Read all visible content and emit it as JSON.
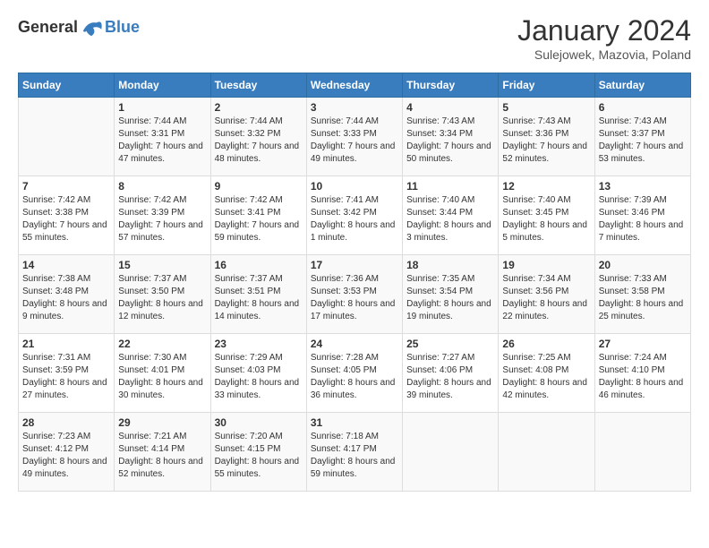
{
  "header": {
    "logo_general": "General",
    "logo_blue": "Blue",
    "month_title": "January 2024",
    "subtitle": "Sulejowek, Mazovia, Poland"
  },
  "days_of_week": [
    "Sunday",
    "Monday",
    "Tuesday",
    "Wednesday",
    "Thursday",
    "Friday",
    "Saturday"
  ],
  "weeks": [
    [
      {
        "day": "",
        "info": ""
      },
      {
        "day": "1",
        "info": "Sunrise: 7:44 AM\nSunset: 3:31 PM\nDaylight: 7 hours and 47 minutes."
      },
      {
        "day": "2",
        "info": "Sunrise: 7:44 AM\nSunset: 3:32 PM\nDaylight: 7 hours and 48 minutes."
      },
      {
        "day": "3",
        "info": "Sunrise: 7:44 AM\nSunset: 3:33 PM\nDaylight: 7 hours and 49 minutes."
      },
      {
        "day": "4",
        "info": "Sunrise: 7:43 AM\nSunset: 3:34 PM\nDaylight: 7 hours and 50 minutes."
      },
      {
        "day": "5",
        "info": "Sunrise: 7:43 AM\nSunset: 3:36 PM\nDaylight: 7 hours and 52 minutes."
      },
      {
        "day": "6",
        "info": "Sunrise: 7:43 AM\nSunset: 3:37 PM\nDaylight: 7 hours and 53 minutes."
      }
    ],
    [
      {
        "day": "7",
        "info": "Sunrise: 7:42 AM\nSunset: 3:38 PM\nDaylight: 7 hours and 55 minutes."
      },
      {
        "day": "8",
        "info": "Sunrise: 7:42 AM\nSunset: 3:39 PM\nDaylight: 7 hours and 57 minutes."
      },
      {
        "day": "9",
        "info": "Sunrise: 7:42 AM\nSunset: 3:41 PM\nDaylight: 7 hours and 59 minutes."
      },
      {
        "day": "10",
        "info": "Sunrise: 7:41 AM\nSunset: 3:42 PM\nDaylight: 8 hours and 1 minute."
      },
      {
        "day": "11",
        "info": "Sunrise: 7:40 AM\nSunset: 3:44 PM\nDaylight: 8 hours and 3 minutes."
      },
      {
        "day": "12",
        "info": "Sunrise: 7:40 AM\nSunset: 3:45 PM\nDaylight: 8 hours and 5 minutes."
      },
      {
        "day": "13",
        "info": "Sunrise: 7:39 AM\nSunset: 3:46 PM\nDaylight: 8 hours and 7 minutes."
      }
    ],
    [
      {
        "day": "14",
        "info": "Sunrise: 7:38 AM\nSunset: 3:48 PM\nDaylight: 8 hours and 9 minutes."
      },
      {
        "day": "15",
        "info": "Sunrise: 7:37 AM\nSunset: 3:50 PM\nDaylight: 8 hours and 12 minutes."
      },
      {
        "day": "16",
        "info": "Sunrise: 7:37 AM\nSunset: 3:51 PM\nDaylight: 8 hours and 14 minutes."
      },
      {
        "day": "17",
        "info": "Sunrise: 7:36 AM\nSunset: 3:53 PM\nDaylight: 8 hours and 17 minutes."
      },
      {
        "day": "18",
        "info": "Sunrise: 7:35 AM\nSunset: 3:54 PM\nDaylight: 8 hours and 19 minutes."
      },
      {
        "day": "19",
        "info": "Sunrise: 7:34 AM\nSunset: 3:56 PM\nDaylight: 8 hours and 22 minutes."
      },
      {
        "day": "20",
        "info": "Sunrise: 7:33 AM\nSunset: 3:58 PM\nDaylight: 8 hours and 25 minutes."
      }
    ],
    [
      {
        "day": "21",
        "info": "Sunrise: 7:31 AM\nSunset: 3:59 PM\nDaylight: 8 hours and 27 minutes."
      },
      {
        "day": "22",
        "info": "Sunrise: 7:30 AM\nSunset: 4:01 PM\nDaylight: 8 hours and 30 minutes."
      },
      {
        "day": "23",
        "info": "Sunrise: 7:29 AM\nSunset: 4:03 PM\nDaylight: 8 hours and 33 minutes."
      },
      {
        "day": "24",
        "info": "Sunrise: 7:28 AM\nSunset: 4:05 PM\nDaylight: 8 hours and 36 minutes."
      },
      {
        "day": "25",
        "info": "Sunrise: 7:27 AM\nSunset: 4:06 PM\nDaylight: 8 hours and 39 minutes."
      },
      {
        "day": "26",
        "info": "Sunrise: 7:25 AM\nSunset: 4:08 PM\nDaylight: 8 hours and 42 minutes."
      },
      {
        "day": "27",
        "info": "Sunrise: 7:24 AM\nSunset: 4:10 PM\nDaylight: 8 hours and 46 minutes."
      }
    ],
    [
      {
        "day": "28",
        "info": "Sunrise: 7:23 AM\nSunset: 4:12 PM\nDaylight: 8 hours and 49 minutes."
      },
      {
        "day": "29",
        "info": "Sunrise: 7:21 AM\nSunset: 4:14 PM\nDaylight: 8 hours and 52 minutes."
      },
      {
        "day": "30",
        "info": "Sunrise: 7:20 AM\nSunset: 4:15 PM\nDaylight: 8 hours and 55 minutes."
      },
      {
        "day": "31",
        "info": "Sunrise: 7:18 AM\nSunset: 4:17 PM\nDaylight: 8 hours and 59 minutes."
      },
      {
        "day": "",
        "info": ""
      },
      {
        "day": "",
        "info": ""
      },
      {
        "day": "",
        "info": ""
      }
    ]
  ]
}
